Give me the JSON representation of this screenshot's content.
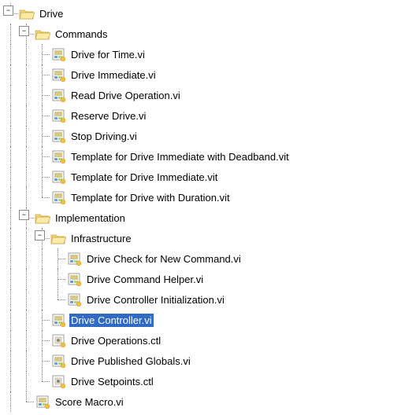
{
  "tree": {
    "drive": {
      "label": "Drive",
      "selected": false,
      "commands": {
        "label": "Commands",
        "items": [
          {
            "label": "Drive for Time.vi",
            "icon": "vi",
            "selected": false
          },
          {
            "label": "Drive Immediate.vi",
            "icon": "vi",
            "selected": false
          },
          {
            "label": "Read Drive Operation.vi",
            "icon": "vi",
            "selected": false
          },
          {
            "label": "Reserve Drive.vi",
            "icon": "vi",
            "selected": false
          },
          {
            "label": "Stop Driving.vi",
            "icon": "vi",
            "selected": false
          },
          {
            "label": "Template for Drive Immediate with Deadband.vit",
            "icon": "vit",
            "selected": false
          },
          {
            "label": "Template for Drive Immediate.vit",
            "icon": "vit",
            "selected": false
          },
          {
            "label": "Template for Drive with Duration.vit",
            "icon": "vit",
            "selected": false
          }
        ]
      },
      "implementation": {
        "label": "Implementation",
        "infrastructure": {
          "label": "Infrastructure",
          "items": [
            {
              "label": "Drive Check for New Command.vi",
              "icon": "vi",
              "selected": false
            },
            {
              "label": "Drive Command Helper.vi",
              "icon": "vi",
              "selected": false
            },
            {
              "label": "Drive Controller Initialization.vi",
              "icon": "vi",
              "selected": false
            }
          ]
        },
        "items": [
          {
            "label": "Drive Controller.vi",
            "icon": "vi",
            "selected": true
          },
          {
            "label": "Drive Operations.ctl",
            "icon": "ctl",
            "selected": false
          },
          {
            "label": "Drive Published Globals.vi",
            "icon": "vi",
            "selected": false
          },
          {
            "label": "Drive Setpoints.ctl",
            "icon": "ctl",
            "selected": false
          }
        ]
      },
      "score_macro": {
        "label": "Score Macro.vi",
        "icon": "vi",
        "selected": false
      }
    }
  },
  "icons": {
    "expand_minus": "−",
    "expand_plus": "+"
  }
}
